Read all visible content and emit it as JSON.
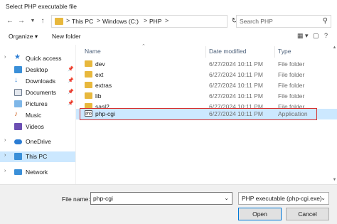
{
  "window": {
    "title": "Select PHP executable file"
  },
  "address": {
    "crumbs": [
      "This PC",
      "Windows (C:)",
      "PHP"
    ],
    "separator": ">"
  },
  "search": {
    "placeholder": "Search PHP"
  },
  "toolbar": {
    "organize": "Organize ▾",
    "new_folder": "New folder"
  },
  "sidebar": {
    "items": [
      {
        "label": "Quick access",
        "icon": "star-icon",
        "color": "#2b7cd3"
      },
      {
        "label": "Desktop",
        "icon": "desktop-icon",
        "color": "#3a8fd8"
      },
      {
        "label": "Downloads",
        "icon": "downloads-icon",
        "color": "#2b7cd3"
      },
      {
        "label": "Documents",
        "icon": "documents-icon",
        "color": "#6d7b8d"
      },
      {
        "label": "Pictures",
        "icon": "pictures-icon",
        "color": "#3a8fd8"
      },
      {
        "label": "Music",
        "icon": "music-icon",
        "color": "#d16a2c"
      },
      {
        "label": "Videos",
        "icon": "videos-icon",
        "color": "#6c4fb3"
      },
      {
        "label": "OneDrive",
        "icon": "onedrive-icon",
        "color": "#2b7cd3"
      },
      {
        "label": "This PC",
        "icon": "pc-icon",
        "color": "#3a8fd8"
      },
      {
        "label": "Network",
        "icon": "network-icon",
        "color": "#3a8fd8"
      }
    ]
  },
  "columns": {
    "name": "Name",
    "date": "Date modified",
    "type": "Type"
  },
  "files": [
    {
      "name": "dev",
      "date": "6/27/2024 10:11 PM",
      "type": "File folder"
    },
    {
      "name": "ext",
      "date": "6/27/2024 10:11 PM",
      "type": "File folder"
    },
    {
      "name": "extras",
      "date": "6/27/2024 10:11 PM",
      "type": "File folder"
    },
    {
      "name": "lib",
      "date": "6/27/2024 10:11 PM",
      "type": "File folder"
    },
    {
      "name": "sasl2",
      "date": "6/27/2024 10:11 PM",
      "type": "File folder"
    },
    {
      "name": "php-cgi",
      "date": "6/27/2024 10:11 PM",
      "type": "Application"
    }
  ],
  "app_icon_text": "php",
  "footer": {
    "file_name_label": "File name:",
    "file_name_value": "php-cgi",
    "file_type": "PHP executable (php-cgi.exe)",
    "open": "Open",
    "cancel": "Cancel"
  },
  "colors": {
    "selection": "#cce8ff",
    "highlight_border": "#d62f2f",
    "folder": "#e8b83d"
  }
}
